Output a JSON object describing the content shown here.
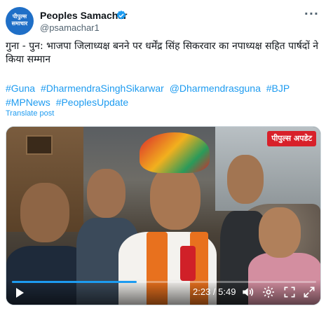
{
  "post": {
    "author": {
      "display_name": "Peoples Samachar",
      "handle": "@psamachar1",
      "avatar_text": "पीपुल्स समाचार",
      "verified": true
    },
    "text": "गुना - पुन: भाजपा जिलाध्यक्ष बनने पर धर्मेंद्र सिंह सिकरवार का नपाध्यक्ष सहित पार्षदों ने किया सम्मान",
    "hashtags": [
      "#Guna",
      "#DharmendraSinghSikarwar",
      "@Dharmendrasguna",
      "#BJP",
      "#MPNews",
      "#PeoplesUpdate"
    ],
    "translate_label": "Translate post"
  },
  "video": {
    "overlay_logo": "पीपुल्स अपडेट",
    "time_display": "2:23 / 5:49",
    "progress_fraction": 0.41,
    "icons": [
      "play-icon",
      "volume-icon",
      "settings-icon",
      "fullscreen-icon",
      "more-icon",
      "verified-icon"
    ]
  },
  "colors": {
    "accent": "#1d9bf0",
    "text": "#0f1419",
    "muted": "#536471",
    "avatar_bg": "#1f6fc7",
    "logo_red": "#d8202a"
  }
}
